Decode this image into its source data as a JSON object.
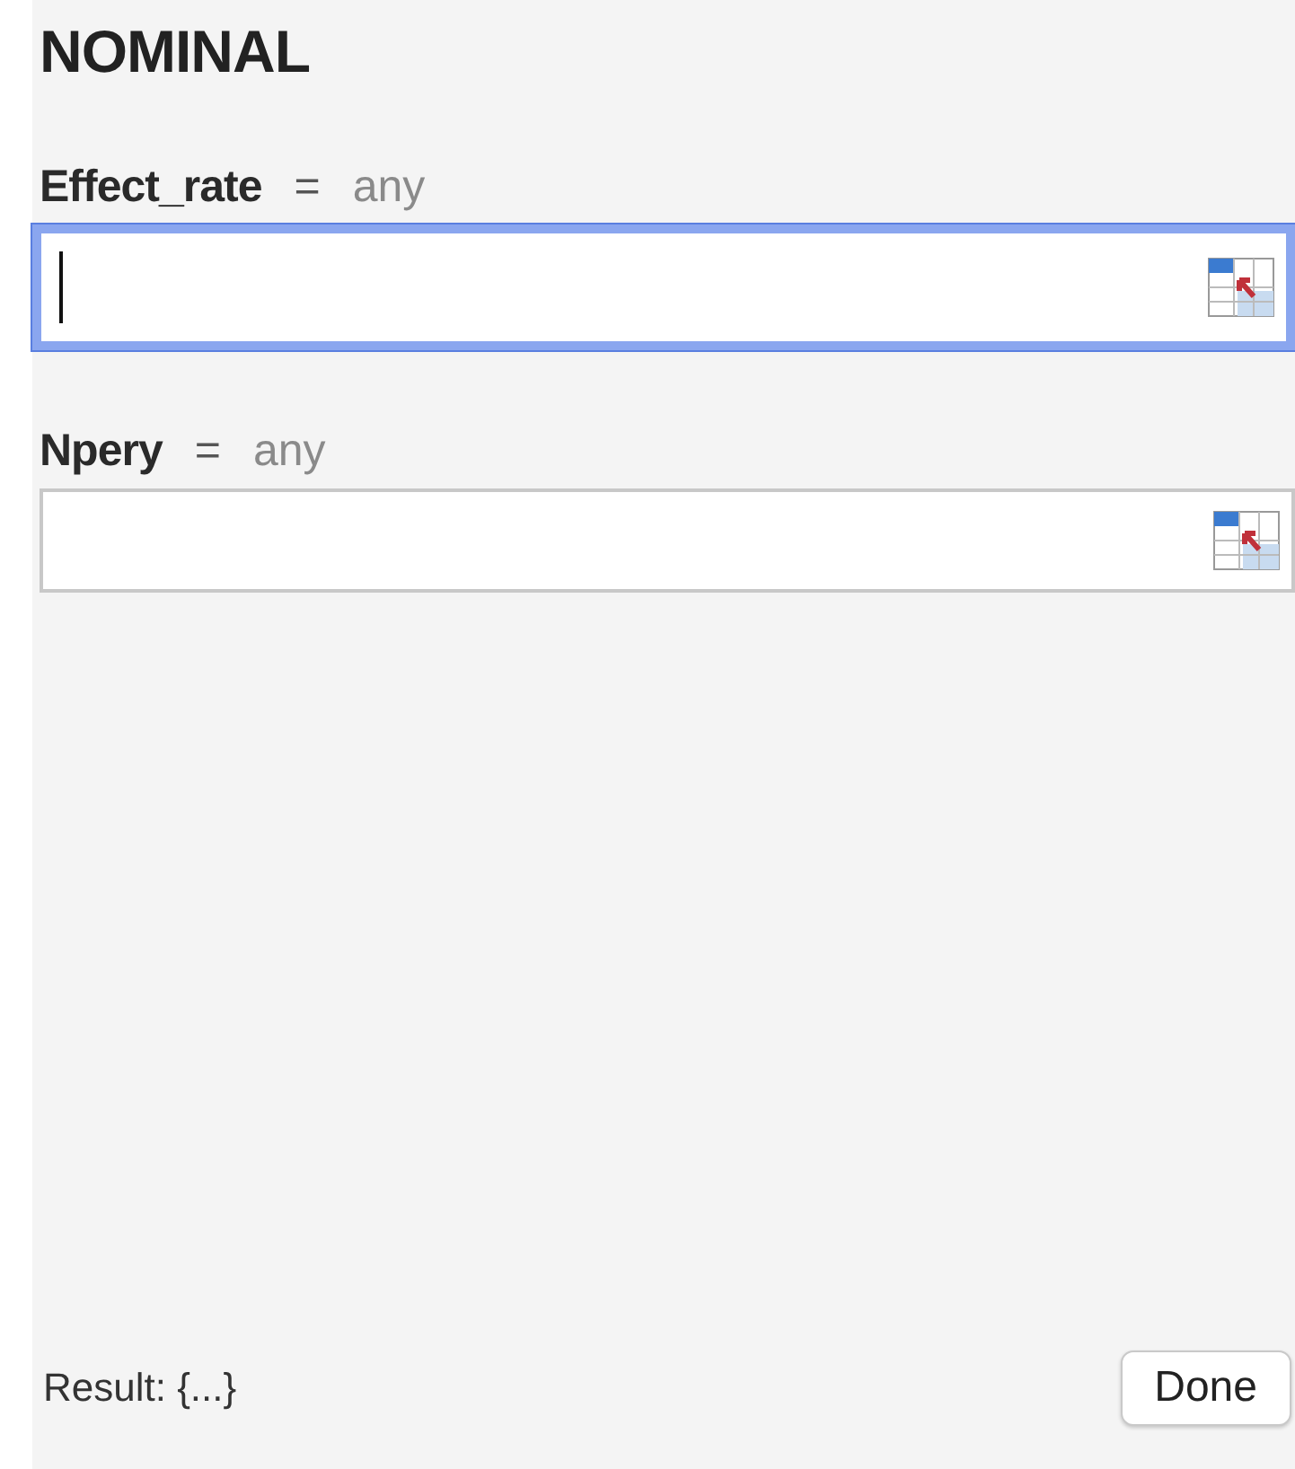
{
  "title": "NOMINAL",
  "arguments": [
    {
      "name": "Effect_rate",
      "equals": "=",
      "type": "any",
      "focused": true
    },
    {
      "name": "Npery",
      "equals": "=",
      "type": "any",
      "focused": false
    }
  ],
  "result": "Result: {...}",
  "done_button": "Done"
}
